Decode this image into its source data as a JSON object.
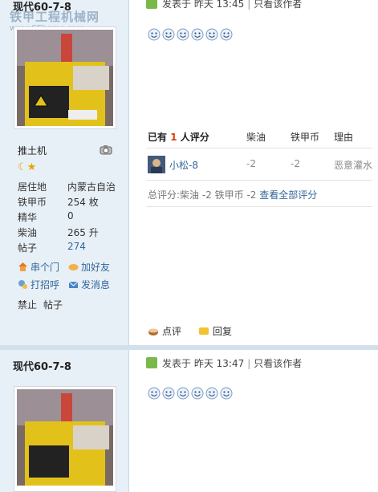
{
  "posts": [
    {
      "username": "现代60-7-8",
      "posted_label": "发表于",
      "posted_time": "昨天 13:45",
      "only_author": "只看该作者",
      "rank": "推土机",
      "info": [
        {
          "label": "居住地",
          "value": "内蒙古自治"
        },
        {
          "label": "铁甲币",
          "value": "254 枚"
        },
        {
          "label": "精华",
          "value": "0"
        },
        {
          "label": "柴油",
          "value": "265 升"
        },
        {
          "label": "帖子",
          "value": "274"
        }
      ],
      "actions": [
        "串个门",
        "加好友",
        "打招呼",
        "发消息"
      ],
      "ban": "禁止",
      "ban_posts": "帖子",
      "rating": {
        "prefix": "已有",
        "count": "1",
        "suffix": "人评分",
        "cols": [
          "柴油",
          "铁甲币",
          "理由"
        ],
        "rows": [
          {
            "user": "小松-8",
            "diesel": "-2",
            "coin": "-2",
            "reason": "恶意灌水"
          }
        ],
        "summary_label": "总评分:",
        "summary_diesel": "柴油 -2",
        "summary_coin": "铁甲币 -2",
        "view_all": "查看全部评分"
      },
      "footer": {
        "comment": "点评",
        "reply": "回复"
      }
    },
    {
      "username": "现代60-7-8",
      "posted_label": "发表于",
      "posted_time": "昨天 13:47",
      "only_author": "只看该作者"
    }
  ],
  "watermark": {
    "line1": "铁甲工程机械网",
    "line2": "www.CEhome.com"
  },
  "colors": {
    "sidebar_bg": "#e8f0f7",
    "link": "#336699",
    "rating_count": "#e03c00",
    "star": "#e8a400"
  },
  "icons": [
    "camera-icon",
    "moon-icon",
    "star-icon",
    "house-icon",
    "handshake-icon",
    "wave-icon",
    "envelope-icon",
    "comment-icon",
    "reply-icon",
    "smiley-icon"
  ]
}
